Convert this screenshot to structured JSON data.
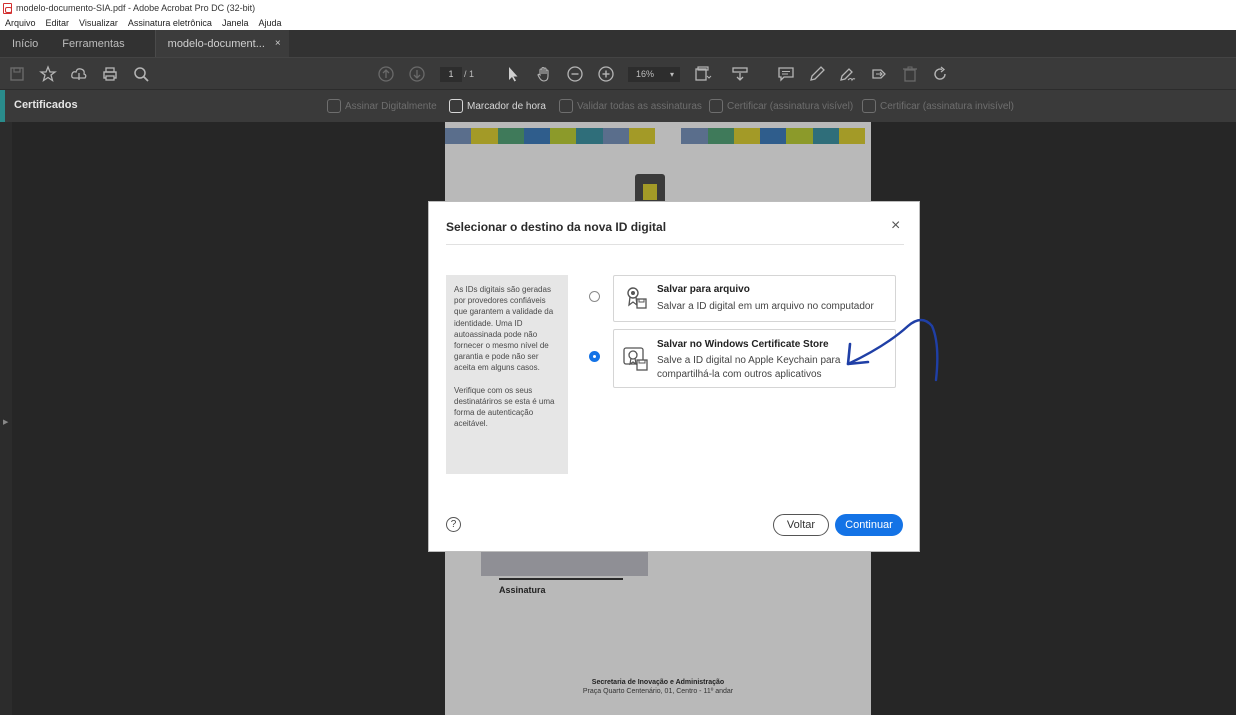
{
  "window": {
    "title": "modelo-documento-SIA.pdf - Adobe Acrobat Pro DC (32-bit)",
    "app_icon": "pdf-icon"
  },
  "menu": [
    "Arquivo",
    "Editar",
    "Visualizar",
    "Assinatura eletrônica",
    "Janela",
    "Ajuda"
  ],
  "tabs": {
    "home": "Início",
    "tools": "Ferramentas",
    "document": "modelo-document...",
    "close": "×"
  },
  "toolbar": {
    "page_current": "1",
    "page_total": "/ 1",
    "zoom": "16%",
    "icons": [
      "save-icon",
      "star-icon",
      "upload-icon",
      "print-icon",
      "search-icon",
      "page-up-icon",
      "page-down-icon",
      "select-arrow-icon",
      "hand-icon",
      "zoom-out-icon",
      "zoom-in-icon",
      "fit-page-icon",
      "scroll-mode-icon",
      "comment-icon",
      "pen-icon",
      "sign-icon",
      "share-icon",
      "delete-icon",
      "rotate-icon"
    ]
  },
  "certbar": {
    "title": "Certificados",
    "tools": [
      {
        "label": "Assinar Digitalmente",
        "enabled": false
      },
      {
        "label": "Marcador de hora",
        "enabled": true
      },
      {
        "label": "Validar todas as assinaturas",
        "enabled": false
      },
      {
        "label": "Certificar (assinatura visível)",
        "enabled": false
      },
      {
        "label": "Certificar (assinatura invisível)",
        "enabled": false
      }
    ],
    "accent_color": "#2a8c8c"
  },
  "document": {
    "signature_label": "Assinatura",
    "footer_line1": "Secretaria de Inovação e Administração",
    "footer_line2": "Praça Quarto Centenário, 01, Centro - 11º andar"
  },
  "dialog": {
    "title": "Selecionar o destino da nova ID digital",
    "close": "×",
    "info": {
      "p1": "As IDs digitais são geradas por provedores confiáveis que garantem a validade da identidade. Uma ID autoassinada pode não fornecer o mesmo nível de garantia e pode não ser aceita em alguns casos.",
      "p2": "Verifique com os seus destinatáriros se esta é uma forma de autenticação aceitável."
    },
    "options": [
      {
        "title": "Salvar para arquivo",
        "desc": "Salvar a ID digital em um arquivo no computador",
        "selected": false,
        "icon": "certificate-file-icon"
      },
      {
        "title": "Salvar no Windows Certificate Store",
        "desc": "Salve a ID digital no Apple Keychain para compartilhá-la com outros aplicativos",
        "selected": true,
        "icon": "certificate-store-icon"
      }
    ],
    "help": "?",
    "back": "Voltar",
    "continue": "Continuar",
    "accent_color": "#1473e6"
  }
}
